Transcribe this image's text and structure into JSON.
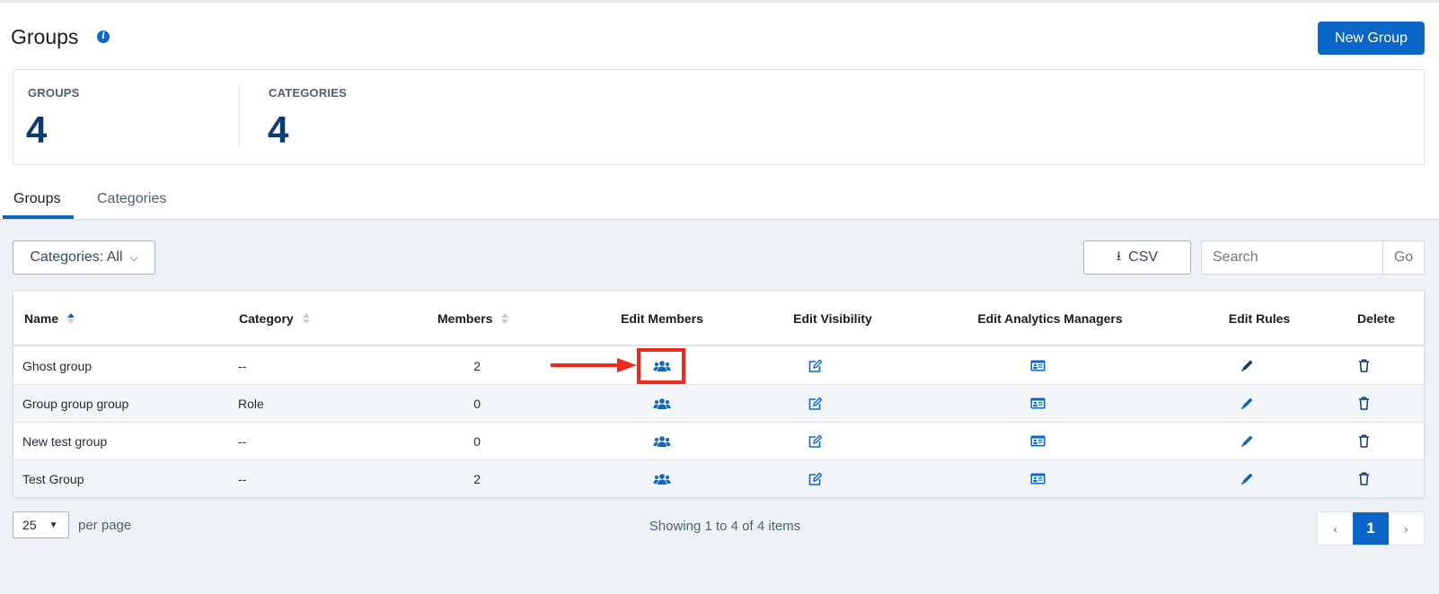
{
  "header": {
    "title": "Groups",
    "new_button": "New Group"
  },
  "stats": [
    {
      "label": "GROUPS",
      "value": "4"
    },
    {
      "label": "CATEGORIES",
      "value": "4"
    }
  ],
  "tabs": [
    {
      "label": "Groups",
      "active": true
    },
    {
      "label": "Categories",
      "active": false
    }
  ],
  "toolbar": {
    "filter_label": "Categories: All",
    "csv_label": "CSV",
    "search_placeholder": "Search",
    "go_label": "Go"
  },
  "table": {
    "columns": [
      "Name",
      "Category",
      "Members",
      "Edit Members",
      "Edit Visibility",
      "Edit Analytics Managers",
      "Edit Rules",
      "Delete"
    ],
    "rows": [
      {
        "name": "Ghost group",
        "category": "--",
        "members": "2"
      },
      {
        "name": "Group group group",
        "category": "Role",
        "members": "0"
      },
      {
        "name": "New test group",
        "category": "--",
        "members": "0"
      },
      {
        "name": "Test Group",
        "category": "--",
        "members": "2"
      }
    ]
  },
  "footer": {
    "per_page": "25",
    "per_page_label": "per page",
    "showing": "Showing 1 to 4 of 4 items",
    "prev": "‹",
    "page": "1",
    "next": "›"
  },
  "colors": {
    "accent": "#0b66c8",
    "annotation": "#ee2a1f"
  }
}
